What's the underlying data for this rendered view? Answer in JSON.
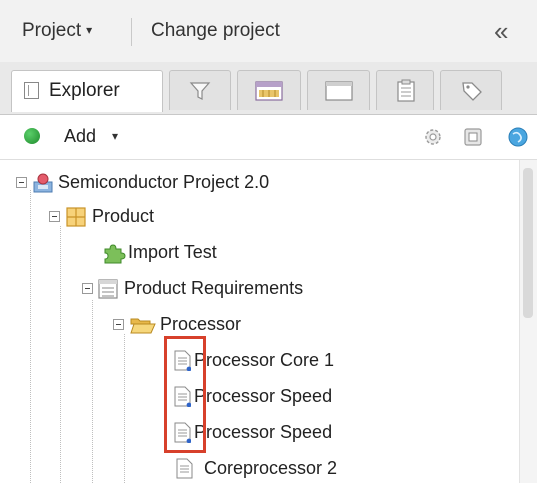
{
  "header": {
    "project_label": "Project",
    "project_caret": "▾",
    "change_project": "Change project",
    "collapse": "«"
  },
  "tabs": [
    {
      "label": "Explorer",
      "icon": "explorer-icon",
      "active": true
    },
    {
      "label": "",
      "icon": "filter-icon",
      "active": false
    },
    {
      "label": "",
      "icon": "baseline-icon",
      "active": false
    },
    {
      "label": "",
      "icon": "window-icon",
      "active": false
    },
    {
      "label": "",
      "icon": "clipboard-icon",
      "active": false
    },
    {
      "label": "",
      "icon": "tag-icon",
      "active": false
    }
  ],
  "toolbar": {
    "add_label": "Add",
    "add_caret": "▾",
    "right_icons": [
      "gear-icon",
      "copy-icon",
      "globe-icon"
    ]
  },
  "tree": {
    "items": [
      {
        "label": "Semiconductor Project 2.0",
        "icon": "project-icon",
        "expanded": true
      },
      {
        "label": "Product",
        "icon": "product-icon",
        "expanded": true
      },
      {
        "label": "Import Test",
        "icon": "puzzle-icon"
      },
      {
        "label": "Product Requirements",
        "icon": "requirements-set-icon",
        "expanded": true
      },
      {
        "label": "Processor",
        "icon": "folder-open-icon",
        "expanded": true
      },
      {
        "label": "Processor Core 1",
        "icon": "document-icon",
        "highlighted": true
      },
      {
        "label": "Processor Speed",
        "icon": "document-icon",
        "highlighted": true
      },
      {
        "label": "Processor Speed",
        "icon": "document-icon",
        "highlighted": true
      },
      {
        "label": "Coreprocessor 2",
        "icon": "document-icon"
      }
    ]
  },
  "colors": {
    "highlight_border": "#d7402b",
    "add_green": "#2fa83f"
  }
}
